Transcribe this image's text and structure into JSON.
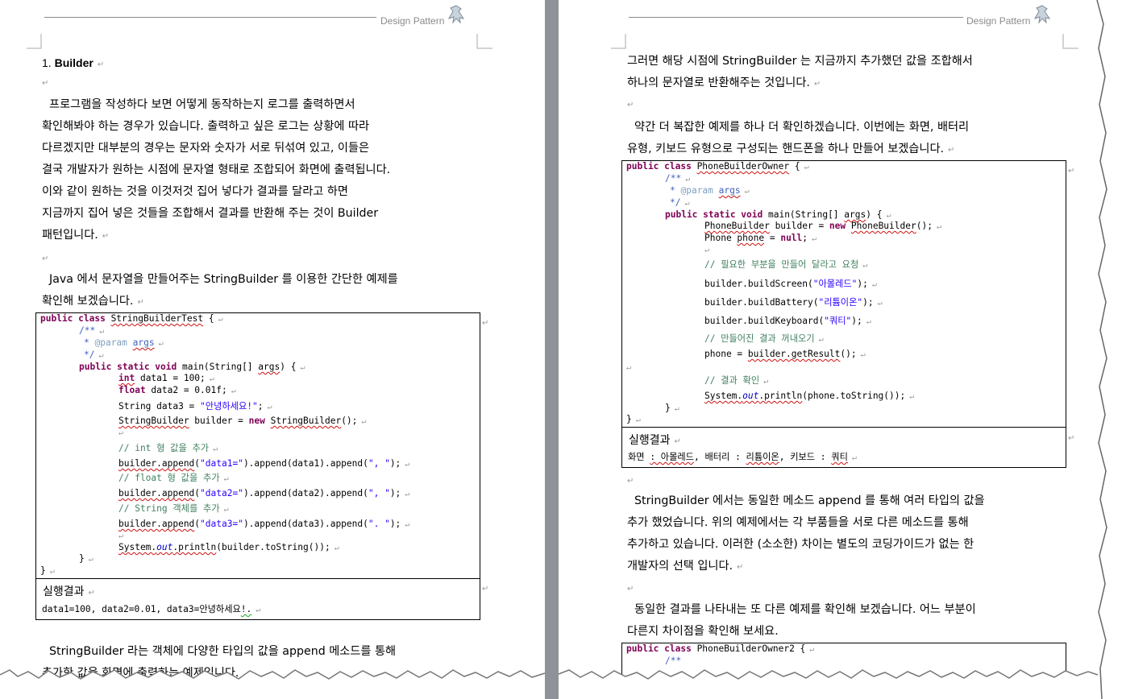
{
  "header": {
    "title": "Design Pattern"
  },
  "left": {
    "heading": "1. Builder",
    "intro_lines": [
      "프로그램을 작성하다 보면 어떻게 동작하는지 로그를 출력하면서",
      "확인해봐야 하는 경우가 있습니다. 출력하고 싶은 로그는 상황에 따라",
      "다르겠지만 대부분의 경우는 문자와 숫자가 서로 뒤섞여 있고, 이들은",
      "결국 개발자가 원하는 시점에 문자열 형태로 조합되어 화면에 출력됩니다.",
      "이와 같이 원하는 것을 이것저것 집어 넣다가 결과를 달라고 하면",
      "지금까지 집어 넣은 것들을 조합해서 결과를 반환해 주는 것이 Builder",
      "패턴입니다."
    ],
    "java_lines": [
      "Java 에서 문자열을 만들어주는 StringBuilder 를 이용한 간단한 예제를",
      "확인해 보겠습니다."
    ],
    "result_label": "실행결과",
    "result_value": "data1=100, data2=0.01, data3=안녕하세요!.",
    "outro_lines": [
      "StringBuilder 라는 객체에 다양한 타입의 값을 append 메소드를 통해",
      "추가한 값을 화면에 출력하는 예제입니다."
    ]
  },
  "right": {
    "top_lines": [
      "그러면 해당 시점에 StringBuilder 는 지금까지 추가했던 값을 조합해서",
      "하나의 문자열로 반환해주는 것입니다."
    ],
    "mid_lines": [
      "약간 더 복잡한 예제를 하나 더 확인하겠습니다. 이번에는 화면, 배터리",
      "유형, 키보드 유형으로 구성되는 핸드폰을 하나 만들어 보겠습니다."
    ],
    "result_label": "실행결과",
    "result_value": "화면 : 아몰레드, 배터리 : 리튬이온, 키보드 : 쿼티",
    "after_lines": [
      "StringBuilder 에서는 동일한 메소드 append 를 통해 여러 타입의 값을",
      "추가 했었습니다. 위의 예제에서는 각 부품들을 서로 다른 메소드를 통해",
      "추가하고 있습니다. 이러한 (소소한) 차이는 별도의 코딩가이드가 없는 한",
      "개발자의 선택 입니다."
    ],
    "last_lines": [
      "동일한 결과를 나타내는 또 다른 예제를 확인해 보겠습니다. 어느 부분이",
      "다른지 차이점을 확인해 보세요."
    ],
    "code3_lines": [
      "public class PhoneBuilderOwner2 {",
      "/**"
    ]
  },
  "code1": {
    "class_line": "public class StringBuilderTest {",
    "doc_open": "/**",
    "doc_param": "* @param args",
    "doc_close": "*/",
    "main_sig": "public static void main(String[] args) {",
    "l1": "int data1 = 100;",
    "l2": "float data2 = 0.01f;",
    "l3a": "String data3 = ",
    "l3b": "\"안녕하세요!\"",
    "l3c": ";",
    "l4": "StringBuilder builder = new StringBuilder();",
    "c1": "// int 형 값을 추가",
    "a1": "builder.append(\"data1=\").append(data1).append(\", \");",
    "c2": "// float 형 값을 추가",
    "a2": "builder.append(\"data2=\").append(data2).append(\", \");",
    "c3": "// String 객체를 추가",
    "a3": "builder.append(\"data3=\").append(data3).append(\". \");",
    "p1": "System.out.println(builder.toString());",
    "close1": "}",
    "close2": "}"
  },
  "code2": {
    "class_line": "public class PhoneBuilderOwner {",
    "doc_open": "/**",
    "doc_param": "* @param args",
    "doc_close": "*/",
    "main_sig": "public static void main(String[] args) {",
    "l1": "PhoneBuilder builder = new PhoneBuilder();",
    "l2": "Phone phone = null;",
    "c1": "// 필요한 부분을 만들어 달라고 요청",
    "b1": "builder.buildScreen(\"아몰레드\");",
    "b2": "builder.buildBattery(\"리튬이온\");",
    "b3": "builder.buildKeyboard(\"쿼티\");",
    "c2": "// 만들어진 결과 꺼내오기",
    "r1": "phone = builder.getResult();",
    "c3": "// 결과 확인",
    "p1": "System.out.println(phone.toString());",
    "close1": "}",
    "close2": "}"
  },
  "colors": {
    "keyword": "#7f0055",
    "comment": "#3f7f5f",
    "javadoc": "#3f5fbf",
    "string": "#2a00ff",
    "gap": "#8f9399"
  }
}
